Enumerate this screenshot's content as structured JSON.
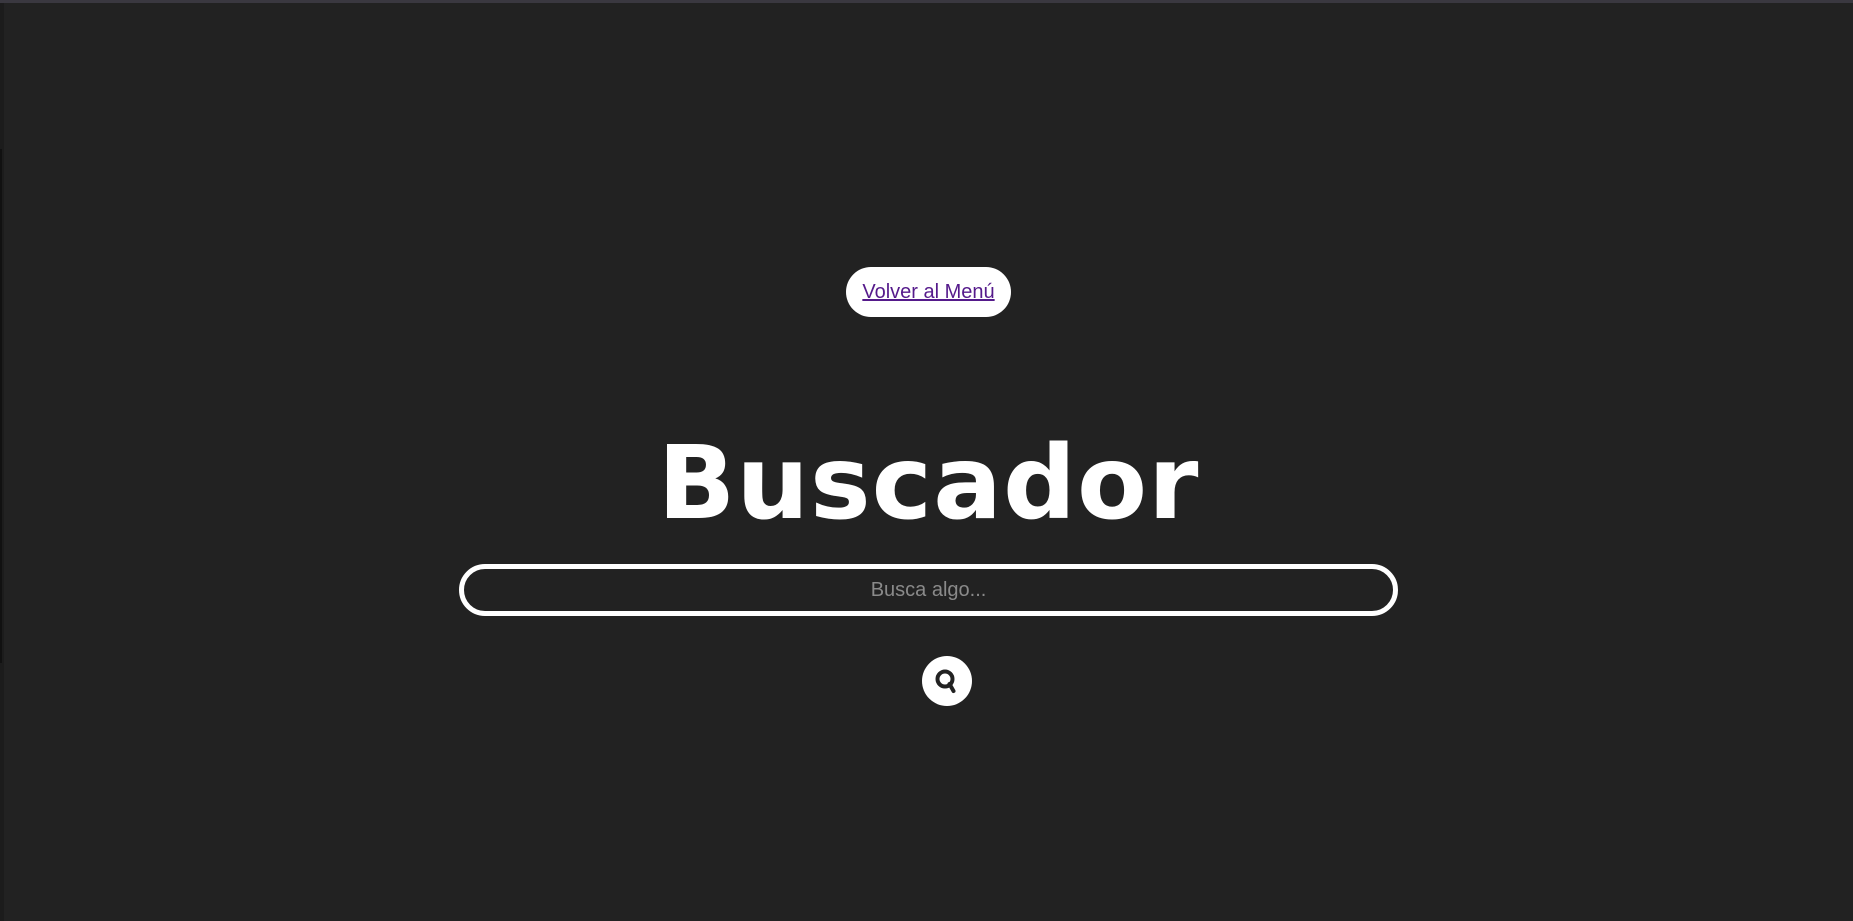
{
  "nav": {
    "back_label": "Volver al Menú"
  },
  "main": {
    "title": "Buscador",
    "search": {
      "placeholder": "Busca algo...",
      "value": ""
    },
    "search_button_icon": "search-icon"
  },
  "colors": {
    "background": "#222222",
    "foreground": "#ffffff",
    "link": "#551a8b",
    "placeholder": "#8a8a8a"
  }
}
